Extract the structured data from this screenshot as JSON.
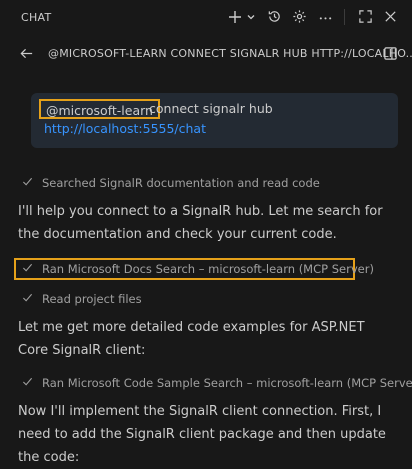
{
  "header": {
    "title": "CHAT",
    "icons": [
      "plus-icon",
      "chevron-down-icon",
      "history-icon",
      "gear-icon",
      "more-icon",
      "maximize-icon",
      "close-icon"
    ]
  },
  "subheader": {
    "back_icon": "arrow-left-icon",
    "title": "@MICROSOFT-LEARN CONNECT SIGNALR HUB HTTP://LOCALHO...",
    "layout_icon": "split-layout-icon"
  },
  "request": {
    "mention": "@microsoft-learn",
    "text": "connect signalr hub",
    "link": "http://localhost:5555/chat"
  },
  "response": {
    "step1": "Searched SignalR documentation and read code",
    "para1": "I'll help you connect to a SignalR hub. Let me search for the documentation and check your current code.",
    "step2": "Ran Microsoft Docs Search – microsoft-learn (MCP Server)",
    "step3": "Read project files",
    "para2": "Let me get more detailed code examples for ASP.NET Core SignalR client:",
    "step4": "Ran Microsoft Code Sample Search – microsoft-learn (MCP Server)",
    "para3": "Now I'll implement the SignalR client connection. First, I need to add the SignalR client package and then update the code:"
  },
  "colors": {
    "background": "#181818",
    "bubble": "#232a33",
    "highlight": "#e5a11a",
    "link": "#3794ff"
  }
}
